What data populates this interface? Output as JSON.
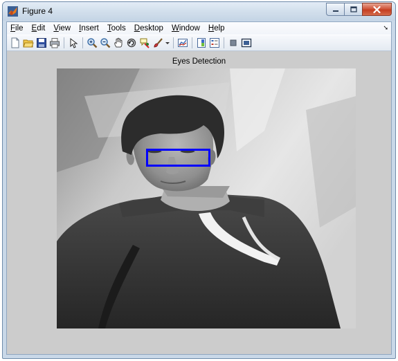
{
  "window": {
    "title": "Figure 4"
  },
  "menu": {
    "items": [
      {
        "label": "File",
        "key": "F",
        "rest": "ile"
      },
      {
        "label": "Edit",
        "key": "E",
        "rest": "dit"
      },
      {
        "label": "View",
        "key": "V",
        "rest": "iew"
      },
      {
        "label": "Insert",
        "key": "I",
        "rest": "nsert"
      },
      {
        "label": "Tools",
        "key": "T",
        "rest": "ools"
      },
      {
        "label": "Desktop",
        "key": "D",
        "rest": "esktop"
      },
      {
        "label": "Window",
        "key": "W",
        "rest": "indow"
      },
      {
        "label": "Help",
        "key": "H",
        "rest": "elp"
      }
    ],
    "dock_glyph": "➘"
  },
  "toolbar": {
    "icons": [
      "new-figure-icon",
      "open-file-icon",
      "save-icon",
      "print-icon",
      "edit-plot-icon",
      "zoom-in-icon",
      "zoom-out-icon",
      "pan-icon",
      "rotate-3d-icon",
      "data-cursor-icon",
      "brush-icon",
      "link-plot-icon",
      "insert-colorbar-icon",
      "insert-legend-icon",
      "hide-plot-tools-icon",
      "show-plot-tools-icon"
    ]
  },
  "axes": {
    "title": "Eyes Detection"
  },
  "detection": {
    "color": "#0000ff",
    "label": "eye-region"
  },
  "colors": {
    "figure_bg": "#cccccc",
    "close_button": "#c53e20"
  }
}
